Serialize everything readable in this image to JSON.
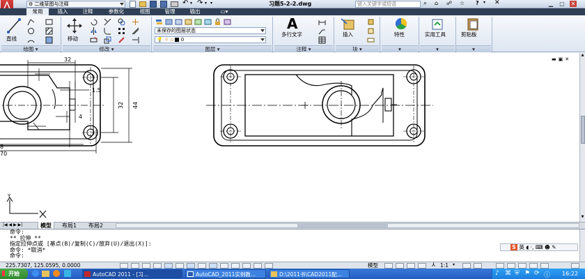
{
  "titlebar": {
    "workspace": "二维草图与注释",
    "filename": "习题5-2-2.dwg",
    "search_placeholder": "键入关键字或短语"
  },
  "ribbon_tabs": [
    "常用",
    "插入",
    "注释",
    "参数化",
    "视图",
    "管理",
    "输出"
  ],
  "ribbon": {
    "line_label": "直线",
    "move_label": "移动",
    "layer_state": "未保存的图层状态",
    "layer_current": "0",
    "mtext_label": "多行文字",
    "insert_label": "插入",
    "properties_label": "特性",
    "utilities_label": "实用工具",
    "clipboard_label": "剪贴板",
    "panels": [
      "绘图",
      "修改",
      "图层",
      "注释",
      "块"
    ]
  },
  "drawing": {
    "dims": {
      "d32": "32",
      "d15": "1.5",
      "d4": "4",
      "v32": "32",
      "v44": "44",
      "d8": "8",
      "d70": "70"
    },
    "ucs_y": "Y",
    "ucs_x": "X"
  },
  "layout_tabs": [
    "模型",
    "布局1",
    "布局2"
  ],
  "command_lines": [
    "命令:",
    "** 拉伸 **",
    "指定拉伸点或 [基点(B)/复制(C)/放弃(U)/退出(X)]:",
    "命令: *取消*",
    "命令:"
  ],
  "ime": {
    "label": "英"
  },
  "statusbar": {
    "coords": "225.7307, 125.0595, 0.0000",
    "model_label": "模型",
    "scale": "1:1"
  },
  "taskbar": {
    "start": "开始",
    "items": [
      "AutoCAD 2011 - [习...",
      "AutoCAD_2011实例教...",
      "D:\\2011书\\CAD2011配..."
    ],
    "clock": "16:22"
  },
  "colors": {
    "accent": "#2f3f55",
    "ribbon_bg": "#dde6f1",
    "taskbar": "#245ec4",
    "app_red": "#c0282d"
  }
}
